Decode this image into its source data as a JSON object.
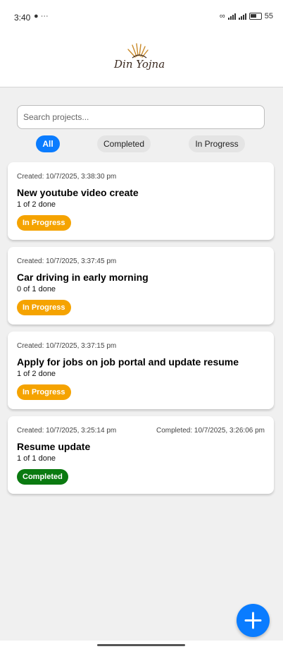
{
  "status_bar": {
    "time": "3:40",
    "left_icons": "● ···",
    "battery": "55"
  },
  "header": {
    "logo_text": "Din Yojna"
  },
  "search": {
    "placeholder": "Search projects..."
  },
  "filters": {
    "all": "All",
    "completed": "Completed",
    "in_progress": "In Progress",
    "active": "All"
  },
  "projects": [
    {
      "created": "Created: 10/7/2025, 3:38:30 pm",
      "completed": "",
      "title": "New youtube video create",
      "count": "1 of 2 done",
      "status": "In Progress"
    },
    {
      "created": "Created: 10/7/2025, 3:37:45 pm",
      "completed": "",
      "title": "Car driving in early morning",
      "count": "0 of 1 done",
      "status": "In Progress"
    },
    {
      "created": "Created: 10/7/2025, 3:37:15 pm",
      "completed": "",
      "title": "Apply for jobs on job portal and update resume",
      "count": "1 of 2 done",
      "status": "In Progress"
    },
    {
      "created": "Created: 10/7/2025, 3:25:14 pm",
      "completed": "Completed: 10/7/2025, 3:26:06 pm",
      "title": "Resume update",
      "count": "1 of 1 done",
      "status": "Completed"
    }
  ],
  "colors": {
    "accent": "#0a7cff",
    "in_progress": "#f5a300",
    "completed": "#0a7a10"
  },
  "icons": {
    "fab": "plus-icon",
    "logo": "sun-rays-icon"
  }
}
